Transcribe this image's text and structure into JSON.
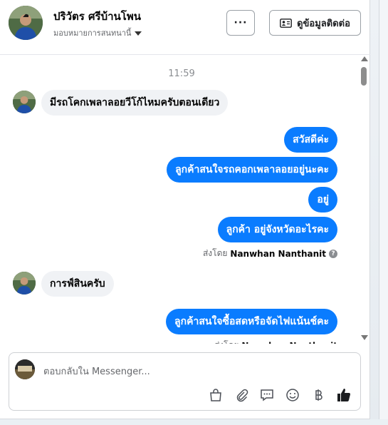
{
  "header": {
    "name": "ปริวัตร ศรีบ้านโพน",
    "assignee": "มอบหมายการสนทนานี้",
    "more_label": "···",
    "contact_button": "ดูข้อมูลติดต่อ"
  },
  "messages": {
    "timestamp": "11:59",
    "items": [
      {
        "dir": "in",
        "text": "มีรถโคกเพลาลอยวีโก้ไหมครับตอนเดียว"
      },
      {
        "dir": "out",
        "text": "สวัสดีค่ะ"
      },
      {
        "dir": "out",
        "text": "ลูกค้าสนใจรถคอกเพลาลอยอยู่นะคะ"
      },
      {
        "dir": "out",
        "text": "อยู่"
      },
      {
        "dir": "out",
        "text": "ลูกค้า อยู่จังหวัดอะไรคะ"
      },
      {
        "dir": "in",
        "text": "การฟ์สินครับ"
      },
      {
        "dir": "out",
        "text": "ลูกค้าสนใจซื้อสดหรือจัดไฟแน้นช์คะ"
      }
    ],
    "sent_by_prefix": "ส่งโดย",
    "sent_by_name": "Nanwhan Nanthanit",
    "sent_by_help": "?"
  },
  "composer": {
    "placeholder": "ตอบกลับใน Messenger...",
    "tools": [
      "bag-icon",
      "attachment-icon",
      "saved-reply-icon",
      "emoji-icon",
      "baht-icon",
      "like-icon"
    ]
  },
  "colors": {
    "outgoing_bubble": "#0a7cff",
    "incoming_bubble": "#f0f2f5",
    "like": "#1c1e21"
  }
}
